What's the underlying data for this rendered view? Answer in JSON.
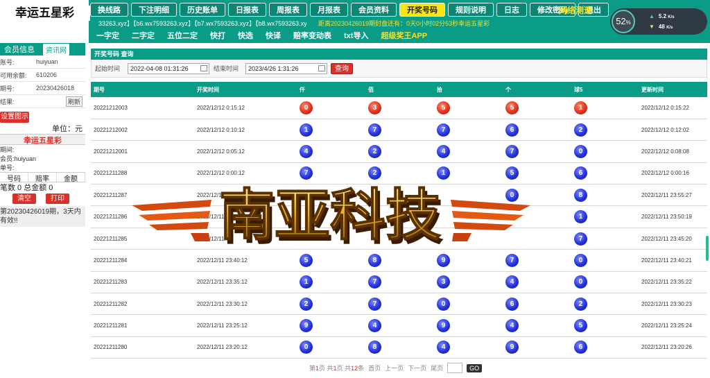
{
  "app": {
    "title": "幸运五星彩"
  },
  "nav1": [
    "换线路",
    "下注明细",
    "历史账单",
    "日报表",
    "周报表",
    "月报表",
    "会员资料",
    "开奖号码",
    "规则说明",
    "日志",
    "修改密码",
    "退出"
  ],
  "nav1_active_index": 7,
  "net_test": "网络测速",
  "ticker": "33263.xyz】【b6.wx7593263.xyz】【b7.wx7593263.xyz】【b8.wx7593263.xyz】【t",
  "countdown": "距离20230426019期封盘还有：0天0小时02分53秒幸运五星彩",
  "nav2": [
    "一字定",
    "二字定",
    "五位二定",
    "快打",
    "快选",
    "快译",
    "赔率变动表",
    "txt导入",
    "超级奖王APP"
  ],
  "meter": {
    "percent": "52",
    "up": "5.2",
    "down": "48",
    "unit_up": "K/s",
    "unit_down": "K/s"
  },
  "sidebar": {
    "tab1": "会员信息",
    "tab2": "资讯网",
    "rows": [
      {
        "k": "账号:",
        "v": "huiyuan"
      },
      {
        "k": "可用余额:",
        "v": "610206"
      },
      {
        "k": "期号:",
        "v": "20230426018"
      },
      {
        "k": "结果:",
        "v": ""
      }
    ],
    "refresh": "刷新",
    "set_icon": "设置图示",
    "unit": "单位：元",
    "lottery": "幸运五星彩",
    "period_label": "期间:",
    "member_label": "会员:huiyuan",
    "number_label": "单号:",
    "bet_headers": [
      "号码",
      "赔率",
      "金额"
    ],
    "total": "笔数 0 总金额 0",
    "clear": "清空",
    "print": "打印",
    "notice": "第20230426019期，3天内有效!!"
  },
  "panel": {
    "title": "开奖号码 查询",
    "start_label": "起始时间",
    "start_value": "2022-04-08 01:31:26",
    "end_label": "结束时间",
    "end_value": "2023/4/26 1:31:26",
    "query": "查询"
  },
  "table": {
    "headers": [
      "期号",
      "开奖时间",
      "仟",
      "佰",
      "拾",
      "个",
      "球5",
      "更新时间"
    ],
    "rows": [
      {
        "period": "20221212003",
        "time": "2022/12/12 0:15:12",
        "balls": [
          "0",
          "3",
          "5",
          "5",
          "1"
        ],
        "color": "red",
        "update": "2022/12/12 0:15:22"
      },
      {
        "period": "20221212002",
        "time": "2022/12/12 0:10:12",
        "balls": [
          "1",
          "7",
          "7",
          "6",
          "2"
        ],
        "color": "blue",
        "update": "2022/12/12 0:12:02"
      },
      {
        "period": "20221212001",
        "time": "2022/12/12 0:05:12",
        "balls": [
          "4",
          "2",
          "4",
          "7",
          "0"
        ],
        "color": "blue",
        "update": "2022/12/12 0:08:08"
      },
      {
        "period": "20221211288",
        "time": "2022/12/12 0:00:12",
        "balls": [
          "7",
          "2",
          "1",
          "5",
          "6"
        ],
        "color": "blue",
        "update": "2022/12/12 0:00:16"
      },
      {
        "period": "20221211287",
        "time": "2022/12/11",
        "balls": [
          "",
          "",
          "",
          "0",
          "8"
        ],
        "color": "blue",
        "update": "2022/12/11 23:55:27"
      },
      {
        "period": "20221211286",
        "time": "2022/12/11",
        "balls": [
          "",
          "",
          "",
          "",
          "1"
        ],
        "color": "blue",
        "update": "2022/12/11 23:50:19"
      },
      {
        "period": "20221211285",
        "time": "2022/12/11",
        "balls": [
          "",
          "",
          "",
          "",
          "7"
        ],
        "color": "blue",
        "update": "2022/12/11 23:45:20"
      },
      {
        "period": "20221211284",
        "time": "2022/12/11 23:40:12",
        "balls": [
          "5",
          "8",
          "9",
          "7",
          "0"
        ],
        "color": "blue",
        "update": "2022/12/11 23:40:21"
      },
      {
        "period": "20221211283",
        "time": "2022/12/11 23:35:12",
        "balls": [
          "1",
          "7",
          "3",
          "4",
          "0"
        ],
        "color": "blue",
        "update": "2022/12/11 23:35:22"
      },
      {
        "period": "20221211282",
        "time": "2022/12/11 23:30:12",
        "balls": [
          "2",
          "7",
          "0",
          "6",
          "2"
        ],
        "color": "blue",
        "update": "2022/12/11 23:30:23"
      },
      {
        "period": "20221211281",
        "time": "2022/12/11 23:25:12",
        "balls": [
          "9",
          "4",
          "9",
          "4",
          "5"
        ],
        "color": "blue",
        "update": "2022/12/11 23:25:24"
      },
      {
        "period": "20221211280",
        "time": "2022/12/11 23:20:12",
        "balls": [
          "0",
          "8",
          "4",
          "9",
          "6"
        ],
        "color": "blue",
        "update": "2022/12/11 23:20:26"
      }
    ]
  },
  "pager": {
    "prefix": "第",
    "page": "1",
    "mid": "页 共",
    "pages": "1",
    "mid2": "页 共",
    "count": "12",
    "suffix": "条",
    "first": "首页",
    "prev": "上一页",
    "next": "下一页",
    "last": "尾页",
    "go": "GO"
  },
  "watermark": {
    "text": "南亚科技"
  }
}
